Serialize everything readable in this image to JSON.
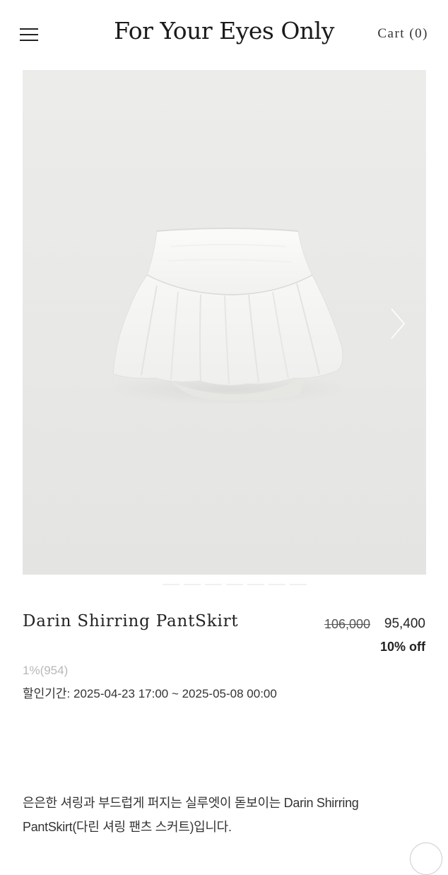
{
  "header": {
    "menu_icon": "hamburger-menu-icon",
    "brand": "For Your Eyes Only",
    "cart_label": "Cart (0)"
  },
  "gallery": {
    "image_alt": "white shirred pant skirt product photo",
    "next_icon": "chevron-right-icon",
    "background_color": "#e9e9e7"
  },
  "product": {
    "name": "Darin Shirring PantSkirt",
    "original_price": "106,000",
    "sale_price": "95,400",
    "discount": "10% off",
    "points": "1%(954)",
    "discount_period": "할인기간: 2025-04-23 17:00 ~ 2025-05-08 00:00"
  },
  "description": {
    "line1": "은은한 셔링과 부드럽게 퍼지는 실루엣이 돋보이는 Darin Shirring",
    "line2": "PantSkirt(다린 셔링 팬츠 스커트)입니다."
  },
  "floating": {
    "scroll_top_icon": "scroll-top-icon"
  }
}
